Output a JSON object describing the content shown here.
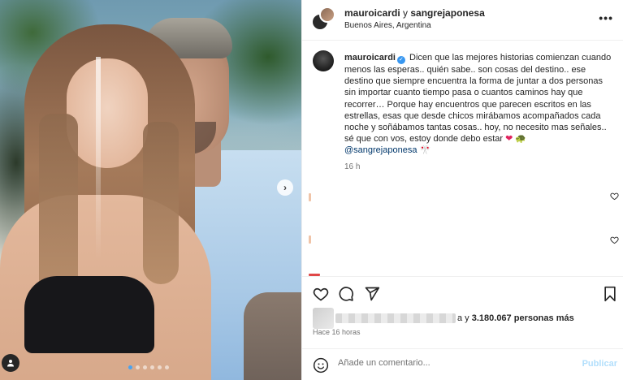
{
  "post": {
    "usernames": {
      "first": "mauroicardi",
      "joiner": " y ",
      "second": "sangrejaponesa"
    },
    "location": "Buenos Aires, Argentina",
    "more_label": "•••"
  },
  "caption": {
    "author": "mauroicardi",
    "body": "Dicen que las mejores historias comienzan cuando menos las esperas.. quién sabe.. son cosas del destino.. ese destino que siempre encuentra la forma de juntar a dos personas sin importar cuanto tiempo pasa o cuantos caminos hay que recorrer… Porque hay encuentros que parecen escritos en las estrellas, esas que desde chicos mirábamos acompañados cada noche y soñábamos tantas cosas.. hoy, no necesito mas señales.. sé que con vos, estoy donde debo estar ",
    "heart": "❤",
    "mention": "@sangrejaponesa",
    "mention_suffix": " 🎌",
    "time": "16 h"
  },
  "likes": {
    "text_prefix": "a y ",
    "count": "3.180.067",
    "text_suffix": " personas más"
  },
  "time_ago": "Hace 16 horas",
  "comment_box": {
    "placeholder": "Añade un comentario...",
    "publish_label": "Publicar"
  },
  "carousel": {
    "next_label": "›",
    "total_slides": 6,
    "active_index": 0
  },
  "colors": {
    "accent": "#3897f0",
    "publish_disabled": "#b2dffc",
    "text": "#262626",
    "muted": "#737373"
  },
  "icons": [
    "ellipsis-icon",
    "verified-icon",
    "heart-icon",
    "comment-icon",
    "share-icon",
    "bookmark-icon",
    "emoji-icon",
    "user-tag-icon",
    "chevron-right-icon"
  ]
}
